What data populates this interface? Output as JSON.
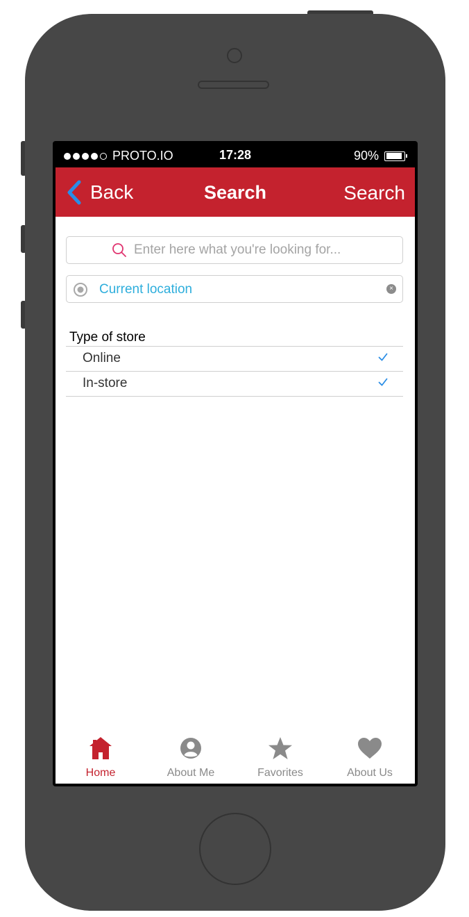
{
  "status_bar": {
    "carrier": "PROTO.IO",
    "time": "17:28",
    "battery_percent": "90%",
    "battery_level": 0.9
  },
  "nav": {
    "back_label": "Back",
    "title": "Search",
    "action_label": "Search",
    "color": "#c4222e"
  },
  "search": {
    "placeholder": "Enter here what you're looking for...",
    "value": ""
  },
  "location": {
    "label": "Current location",
    "color": "#2eaedc"
  },
  "store_type": {
    "heading": "Type of store",
    "options": [
      {
        "label": "Online",
        "checked": true
      },
      {
        "label": "In-store",
        "checked": true
      }
    ]
  },
  "tabs": [
    {
      "label": "Home",
      "icon": "home-icon",
      "active": true
    },
    {
      "label": "About Me",
      "icon": "user-circle-icon",
      "active": false
    },
    {
      "label": "Favorites",
      "icon": "star-icon",
      "active": false
    },
    {
      "label": "About Us",
      "icon": "heart-icon",
      "active": false
    }
  ]
}
